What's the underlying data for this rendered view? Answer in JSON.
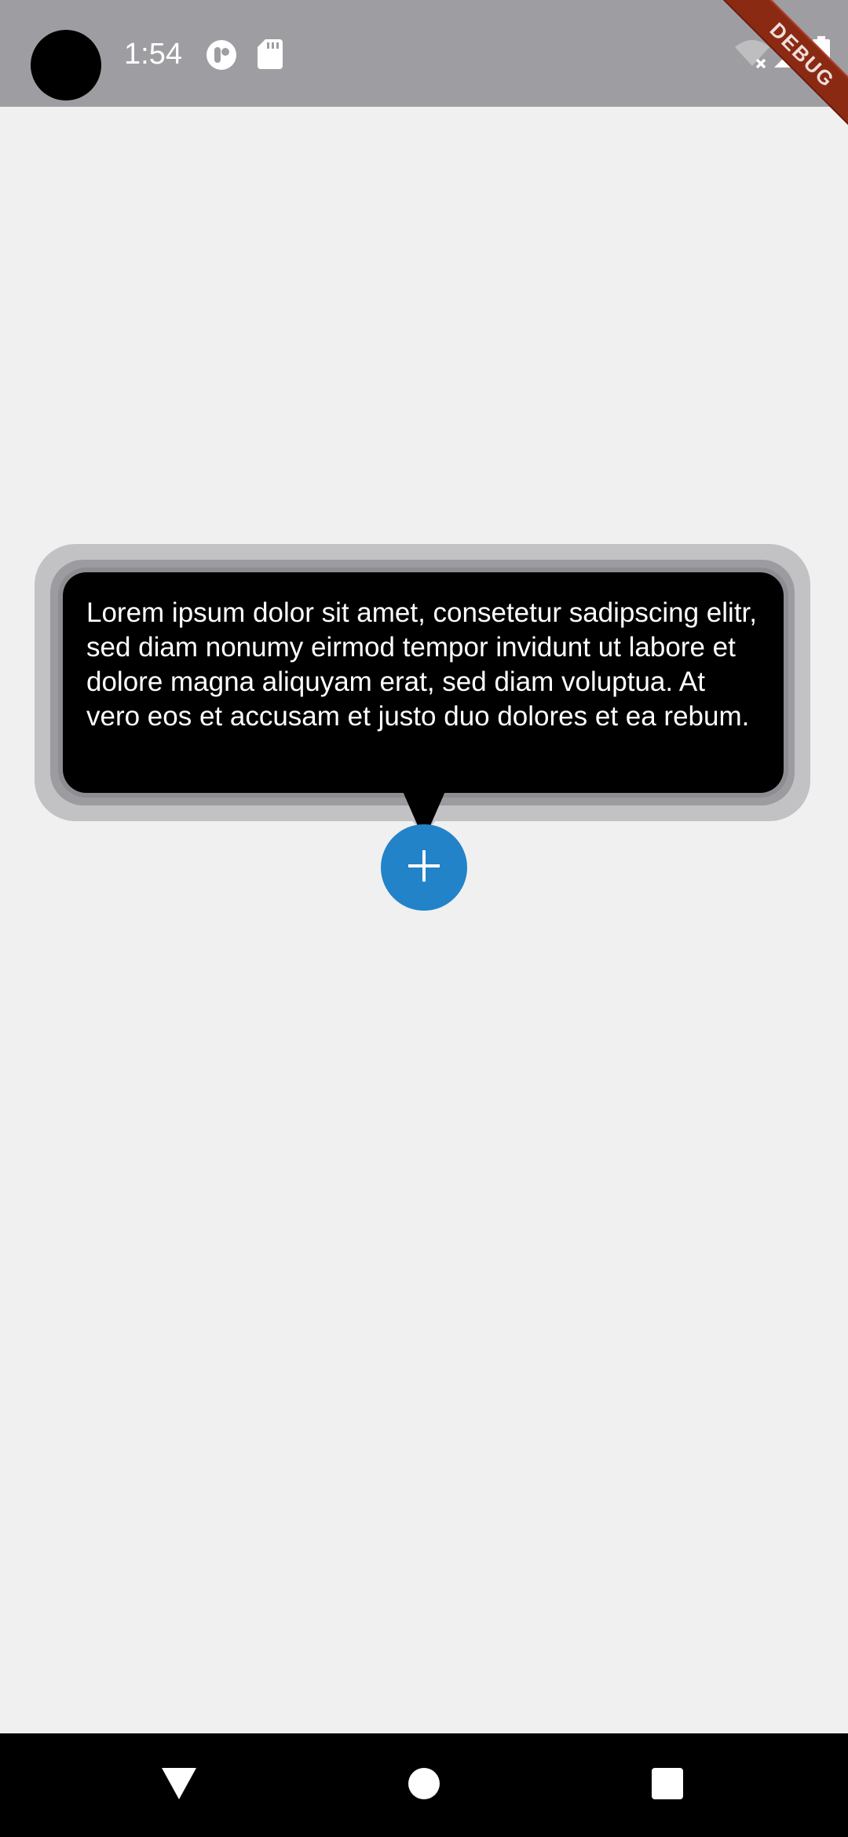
{
  "status_bar": {
    "time": "1:54",
    "icons": [
      "podcast-icon",
      "sd-card-icon",
      "wifi-off-icon",
      "signal-icon",
      "battery-icon"
    ],
    "debug_banner": "DEBUG",
    "background": "#9e9ea2"
  },
  "tooltip": {
    "message": "Lorem ipsum dolor sit amet, consetetur sadipscing elitr, sed diam nonumy eirmod tempor invidunt ut labore et dolore magna aliquyam erat, sed diam voluptua. At vero eos et accusam et justo duo dolores et ea rebum.",
    "background": "#000000",
    "text_color": "#ffffff"
  },
  "fab": {
    "icon": "plus-icon",
    "color": "#2283c8"
  },
  "nav_bar": {
    "buttons": [
      "back-icon",
      "home-icon",
      "recents-icon"
    ]
  },
  "colors": {
    "page_background": "#f0f0f0"
  }
}
